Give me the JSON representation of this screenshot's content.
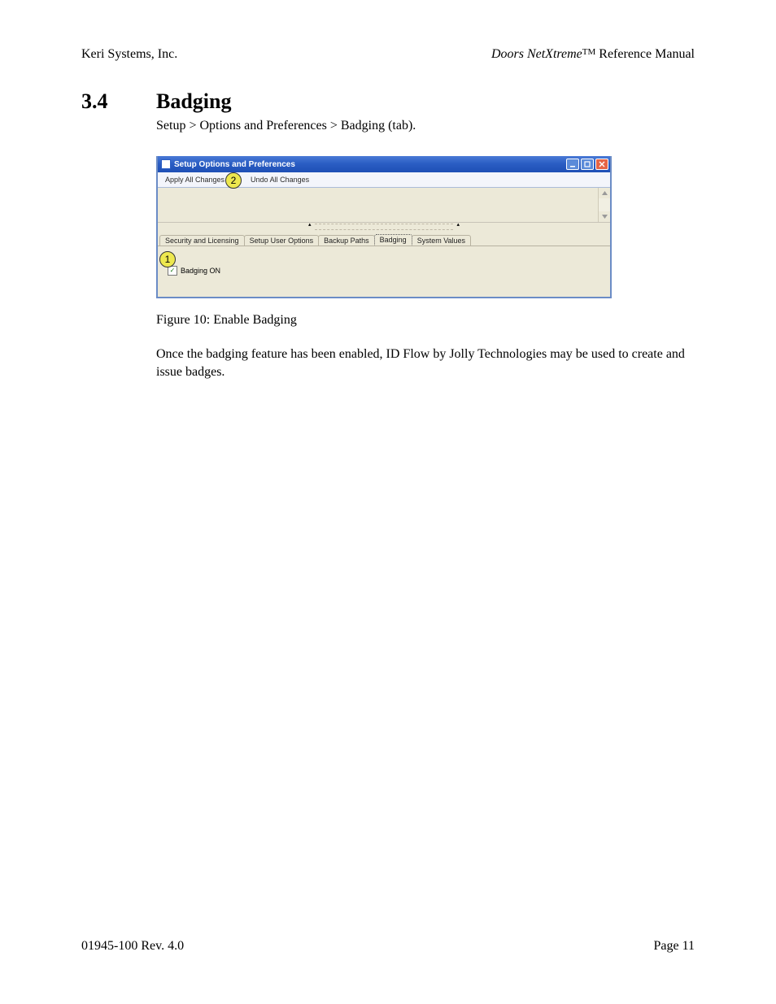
{
  "header": {
    "left": "Keri Systems, Inc.",
    "right_product": "Doors NetXtreme",
    "right_tm": "TM",
    "right_tail": " Reference Manual"
  },
  "section": {
    "number": "3.4",
    "title": "Badging"
  },
  "breadcrumb": "Setup > Options and Preferences > Badging (tab).",
  "screenshot": {
    "titlebar": "Setup Options and Preferences",
    "toolbar": {
      "apply": "Apply All Changes",
      "undo": "Undo All Changes"
    },
    "tabs": [
      "Security and Licensing",
      "Setup User Options",
      "Backup Paths",
      "Badging",
      "System Values"
    ],
    "active_tab_index": 3,
    "checkbox_label": "Badging ON",
    "callouts": {
      "c1": "1",
      "c2": "2"
    }
  },
  "figure_caption": "Figure 10: Enable Badging",
  "body": "Once the badging feature has been enabled, ID Flow by Jolly Technologies may be used to create and issue badges.",
  "footer": {
    "left": "01945-100  Rev. 4.0",
    "right": "Page 11"
  }
}
